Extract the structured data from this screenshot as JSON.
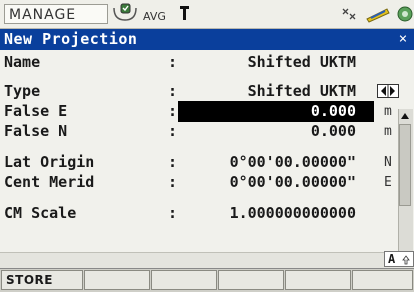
{
  "statusbar": {
    "menu_label": "MANAGE",
    "avg_label": "AVG",
    "icons": [
      "satellite-icon",
      "pole-icon",
      "radio-icon",
      "battery-icon",
      "memory-card-icon"
    ]
  },
  "dialog": {
    "title": "New Projection",
    "close_symbol": "×"
  },
  "fields": [
    {
      "label": "Name",
      "colon": ":",
      "value": "Shifted UKTM",
      "unit": ""
    },
    {
      "label": "Type",
      "colon": ":",
      "value": "Shifted UKTM",
      "unit": ""
    },
    {
      "label": "False E",
      "colon": ":",
      "value": "0.000",
      "unit": "m"
    },
    {
      "label": "False N",
      "colon": ":",
      "value": "0.000",
      "unit": "m"
    },
    {
      "label": "Lat Origin",
      "colon": ":",
      "value": "0°00'00.00000\"",
      "unit": "N"
    },
    {
      "label": "Cent Merid",
      "colon": ":",
      "value": "0°00'00.00000\"",
      "unit": "E"
    },
    {
      "label": "CM Scale",
      "colon": ":",
      "value": "1.000000000000",
      "unit": ""
    }
  ],
  "footer": {
    "input_mode": "A",
    "fkeys": [
      "STORE",
      "",
      "",
      "",
      "",
      ""
    ]
  },
  "colors": {
    "titlebar": "#0a3f9c",
    "background": "#f1f1ec",
    "selection": "#000000"
  }
}
